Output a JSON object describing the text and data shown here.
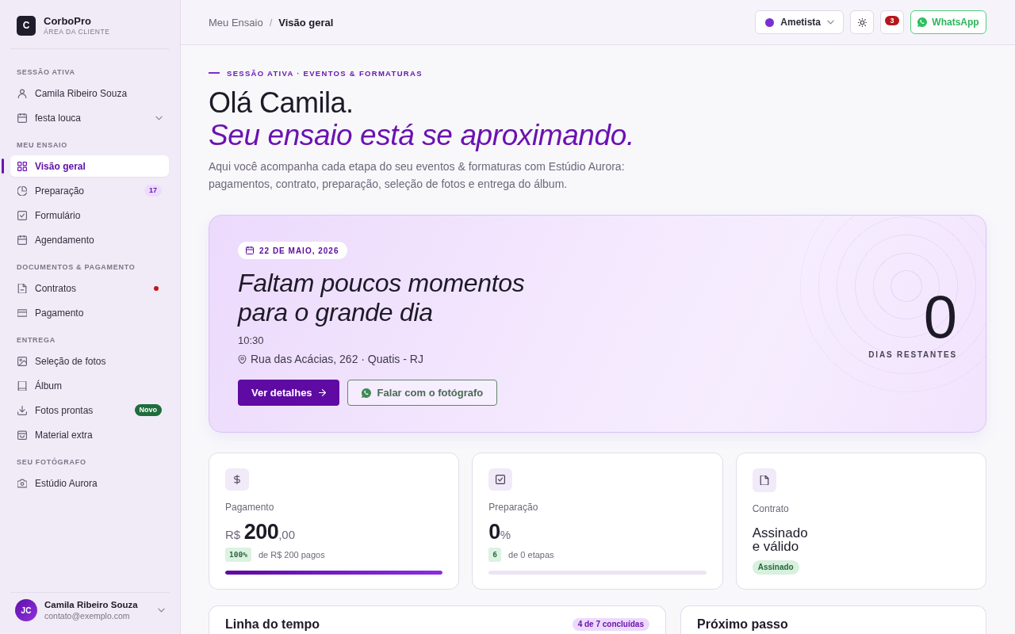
{
  "sidebar": {
    "brand": {
      "logo": "C",
      "name": "CorboPro",
      "tagline": "ÁREA DA CLIENTE"
    },
    "active_session": {
      "title": "SESSÃO ATIVA",
      "client": "Camila Ribeiro Souza",
      "event": "festa louca"
    },
    "nav_sections": [
      {
        "title": "MEU ENSAIO",
        "items": [
          {
            "label": "Visão geral",
            "selected": true,
            "alert": false
          },
          {
            "label": "Preparação",
            "selected": false,
            "alert": false,
            "badge": {
              "kind": "count",
              "text": "17"
            }
          },
          {
            "label": "Formulário",
            "selected": false,
            "alert": false
          },
          {
            "label": "Agendamento",
            "selected": false,
            "alert": false
          }
        ]
      },
      {
        "title": "DOCUMENTOS & PAGAMENTO",
        "items": [
          {
            "label": "Contratos",
            "selected": false,
            "alert": true
          },
          {
            "label": "Pagamento",
            "selected": false,
            "alert": false
          }
        ]
      },
      {
        "title": "ENTREGA",
        "items": [
          {
            "label": "Seleção de fotos",
            "selected": false,
            "alert": false
          },
          {
            "label": "Álbum",
            "selected": false,
            "alert": false
          },
          {
            "label": "Fotos prontas",
            "selected": false,
            "alert": false,
            "badge": {
              "kind": "new",
              "text": "Novo"
            }
          },
          {
            "label": "Material extra",
            "selected": false,
            "alert": false
          }
        ]
      },
      {
        "title": "SEU FOTÓGRAFO",
        "items": [
          {
            "label": "Estúdio Aurora",
            "selected": false,
            "alert": false
          }
        ]
      }
    ],
    "user": {
      "initials": "JC",
      "name": "Camila Ribeiro Souza",
      "email": "contato@exemplo.com"
    }
  },
  "topbar": {
    "breadcrumb": [
      "Meu Ensaio",
      "Visão geral"
    ],
    "separator": "/",
    "theme": "Ametista",
    "notifications": "3",
    "whatsapp": "WhatsApp"
  },
  "hero": {
    "eyebrow": "SESSÃO ATIVA · EVENTOS & FORMATURAS",
    "greeting": "Olá Camila.",
    "headline": "Seu ensaio está se aproximando.",
    "description": "Aqui você acompanha cada etapa do seu eventos & formaturas com Estúdio Aurora: pagamentos, contrato, preparação, seleção de fotos e entrega do álbum."
  },
  "event": {
    "date": "22 DE MAIO, 2026",
    "title": "Faltam poucos momentos para o grande dia",
    "time": "10:30",
    "location": "Rua das Acácias, 262 · Quatis - RJ",
    "buttons": [
      {
        "kind": "primary",
        "label": "Ver detalhes"
      },
      {
        "kind": "contact",
        "label": "Falar com o fotógrafo"
      }
    ],
    "countdown": {
      "value": "0",
      "label": "DIAS RESTANTES"
    }
  },
  "stats": [
    {
      "kind": "money",
      "label": "Pagamento",
      "currency": "R$",
      "amount": "200",
      "cents": ",00",
      "pill": "100%",
      "note": "de R$ 200 pagos",
      "level": 1
    },
    {
      "kind": "percent",
      "label": "Preparação",
      "value": "0",
      "unit": "%",
      "pill": "6",
      "note": "de 0 etapas",
      "level": 0
    },
    {
      "kind": "status",
      "label": "Contrato",
      "value": "Assinado e válido",
      "badge": "Assinado"
    }
  ],
  "panels": [
    {
      "title": "Linha do tempo",
      "badge": "4 de 7 concluídas"
    },
    {
      "title": "Próximo passo"
    }
  ]
}
